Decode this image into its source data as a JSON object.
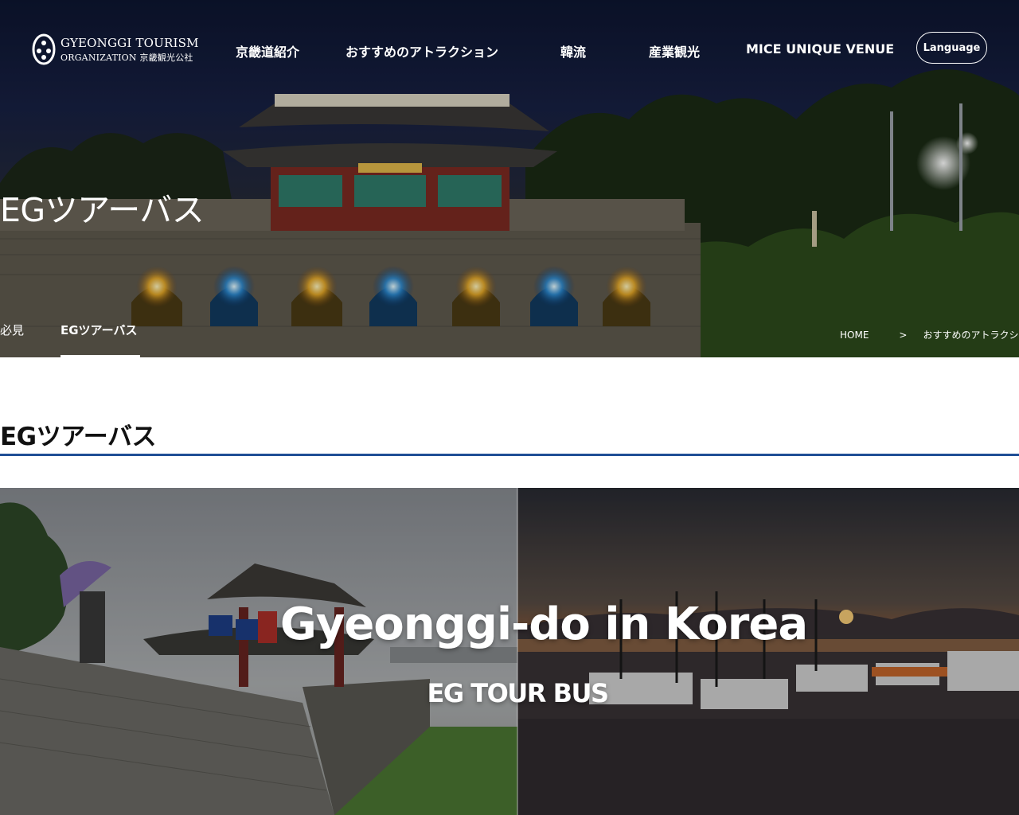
{
  "header": {
    "logo": {
      "line1": "GYEONGGI TOURISM",
      "line2_en": "ORGANIZATION",
      "line2_jp": "京畿観光公社"
    },
    "nav": [
      {
        "label": "京畿道紹介"
      },
      {
        "label": "おすすめのアトラクション"
      },
      {
        "label": "韓流"
      },
      {
        "label": "産業観光"
      },
      {
        "label": "MICE UNIQUE VENUE"
      }
    ],
    "language_button": "Language"
  },
  "hero": {
    "title": "EGツアーバス",
    "subtabs": [
      {
        "label": "必見",
        "active": false
      },
      {
        "label": "EGツアーバス",
        "active": true
      }
    ],
    "breadcrumb": {
      "home": "HOME",
      "separator": ">",
      "current": "おすすめのアトラクション"
    }
  },
  "content": {
    "section_title": "EGツアーバス",
    "accent_color": "#1f4e96",
    "banner": {
      "headline": "Gyeonggi-do in Korea",
      "subtitle": "EG TOUR BUS"
    }
  }
}
